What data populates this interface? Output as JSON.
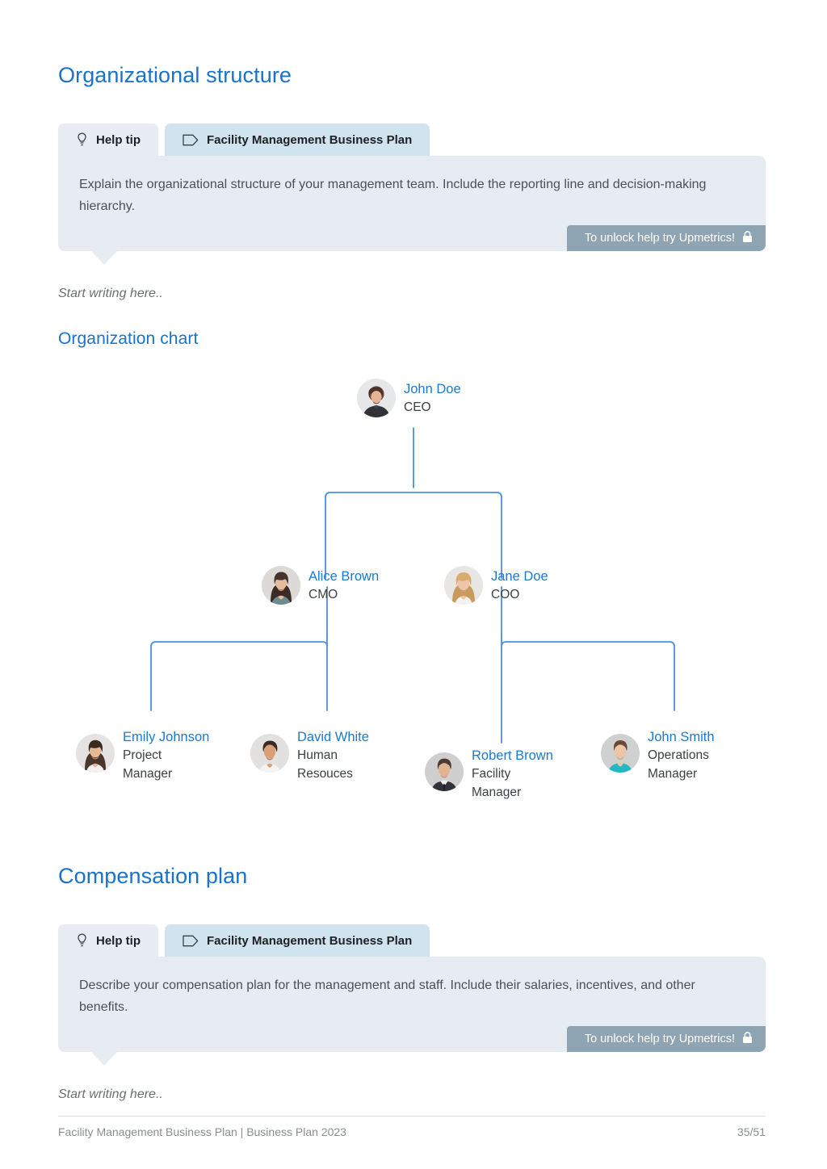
{
  "sections": [
    {
      "heading": "Organizational structure",
      "tabs": {
        "help_label": "Help tip",
        "plan_label": "Facility Management Business Plan"
      },
      "tip_text": "Explain the organizational structure of your management team. Include the reporting line and decision-making hierarchy.",
      "unlock_label": "To unlock help try Upmetrics!",
      "placeholder": "Start writing here.."
    },
    {
      "heading": "Compensation plan",
      "tabs": {
        "help_label": "Help tip",
        "plan_label": "Facility Management Business Plan"
      },
      "tip_text": "Describe your compensation plan for the management and staff. Include their salaries, incentives, and other benefits.",
      "unlock_label": "To unlock help try Upmetrics!",
      "placeholder": "Start writing here.."
    }
  ],
  "org_chart": {
    "heading": "Organization chart",
    "nodes": [
      {
        "id": "ceo",
        "name": "John Doe",
        "role": "CEO"
      },
      {
        "id": "cmo",
        "name": "Alice Brown",
        "role": "CMO"
      },
      {
        "id": "coo",
        "name": "Jane Doe",
        "role": "COO"
      },
      {
        "id": "pm",
        "name": "Emily Johnson",
        "role": "Project Manager"
      },
      {
        "id": "hr",
        "name": "David White",
        "role": "Human Resouces"
      },
      {
        "id": "fm",
        "name": "Robert Brown",
        "role": "Facility Manager"
      },
      {
        "id": "om",
        "name": "John Smith",
        "role": "Operations Manager"
      }
    ],
    "edges": [
      {
        "from": "ceo",
        "to": "cmo"
      },
      {
        "from": "ceo",
        "to": "coo"
      },
      {
        "from": "cmo",
        "to": "pm"
      },
      {
        "from": "cmo",
        "to": "hr"
      },
      {
        "from": "coo",
        "to": "fm"
      },
      {
        "from": "coo",
        "to": "om"
      }
    ],
    "line_color": "#4a90d9"
  },
  "footer": {
    "left": "Facility Management Business Plan | Business Plan 2023",
    "right": "35/51"
  },
  "colors": {
    "heading_blue": "#1a73c8",
    "name_blue": "#1a7ad1",
    "tip_bg": "#e7ebf2",
    "tab_help_bg": "#e8edf3",
    "tab_plan_bg": "#cfe4ef",
    "unlock_bg": "#8fa4b2"
  }
}
